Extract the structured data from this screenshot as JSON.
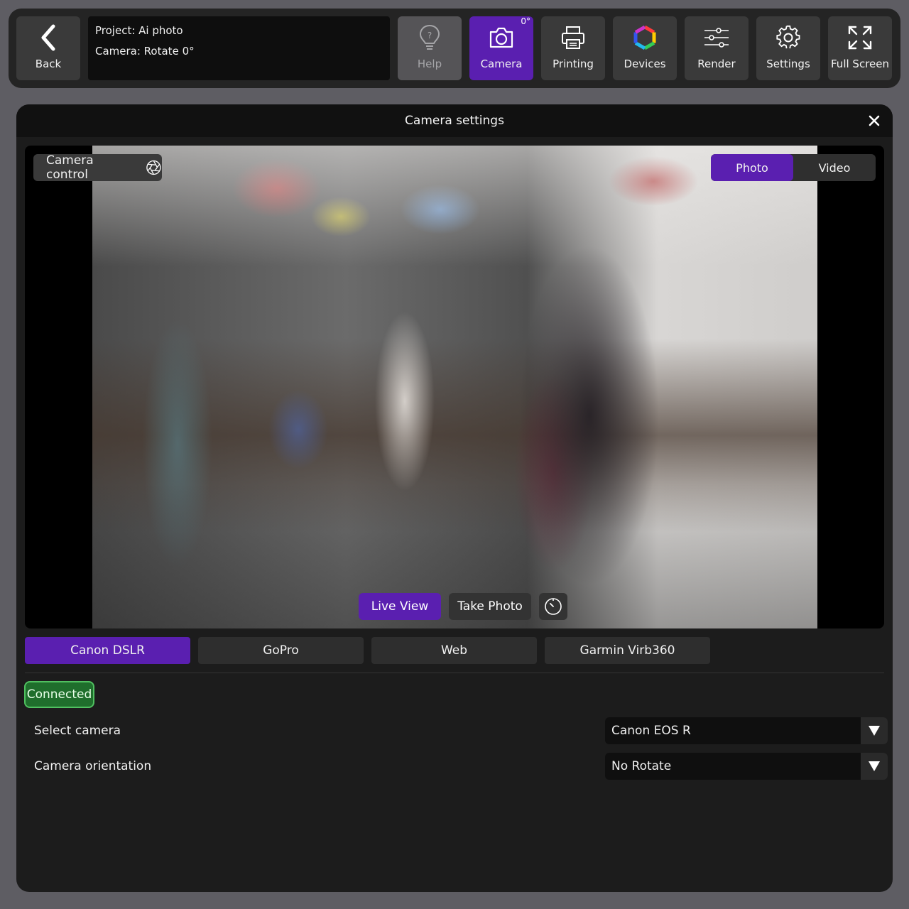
{
  "toolbar": {
    "back_label": "Back",
    "project_line": "Project: Ai photo",
    "camera_line": "Camera: Rotate 0°",
    "help_label": "Help",
    "camera_label": "Camera",
    "camera_badge": "0°",
    "printing_label": "Printing",
    "devices_label": "Devices",
    "render_label": "Render",
    "settings_label": "Settings",
    "fullscreen_label": "Full Screen"
  },
  "dialog": {
    "title": "Camera settings",
    "camera_control_label": "Camera control",
    "mode": {
      "photo": "Photo",
      "video": "Video",
      "selected": "Photo"
    },
    "live_view_label": "Live View",
    "take_photo_label": "Take Photo",
    "sources": [
      "Canon DSLR",
      "GoPro",
      "Web",
      "Garmin Virb360"
    ],
    "active_source": "Canon DSLR",
    "status": "Connected",
    "select_camera_label": "Select camera",
    "select_camera_value": "Canon EOS R",
    "orientation_label": "Camera orientation",
    "orientation_value": "No Rotate"
  },
  "colors": {
    "accent": "#5a1fb0",
    "connected": "#1f6e2c",
    "toolbar_bg": "#242424",
    "dialog_bg": "#1c1c1c"
  },
  "icons": {
    "back": "chevron-left-icon",
    "help": "lightbulb-icon",
    "camera": "camera-icon",
    "printing": "printer-icon",
    "devices": "hexagon-ring-icon",
    "render": "sliders-icon",
    "settings": "gear-icon",
    "fullscreen": "expand-icon",
    "close": "close-icon",
    "camera_control": "aperture-icon",
    "timer": "timer-icon",
    "dropdown": "triangle-down-icon"
  }
}
